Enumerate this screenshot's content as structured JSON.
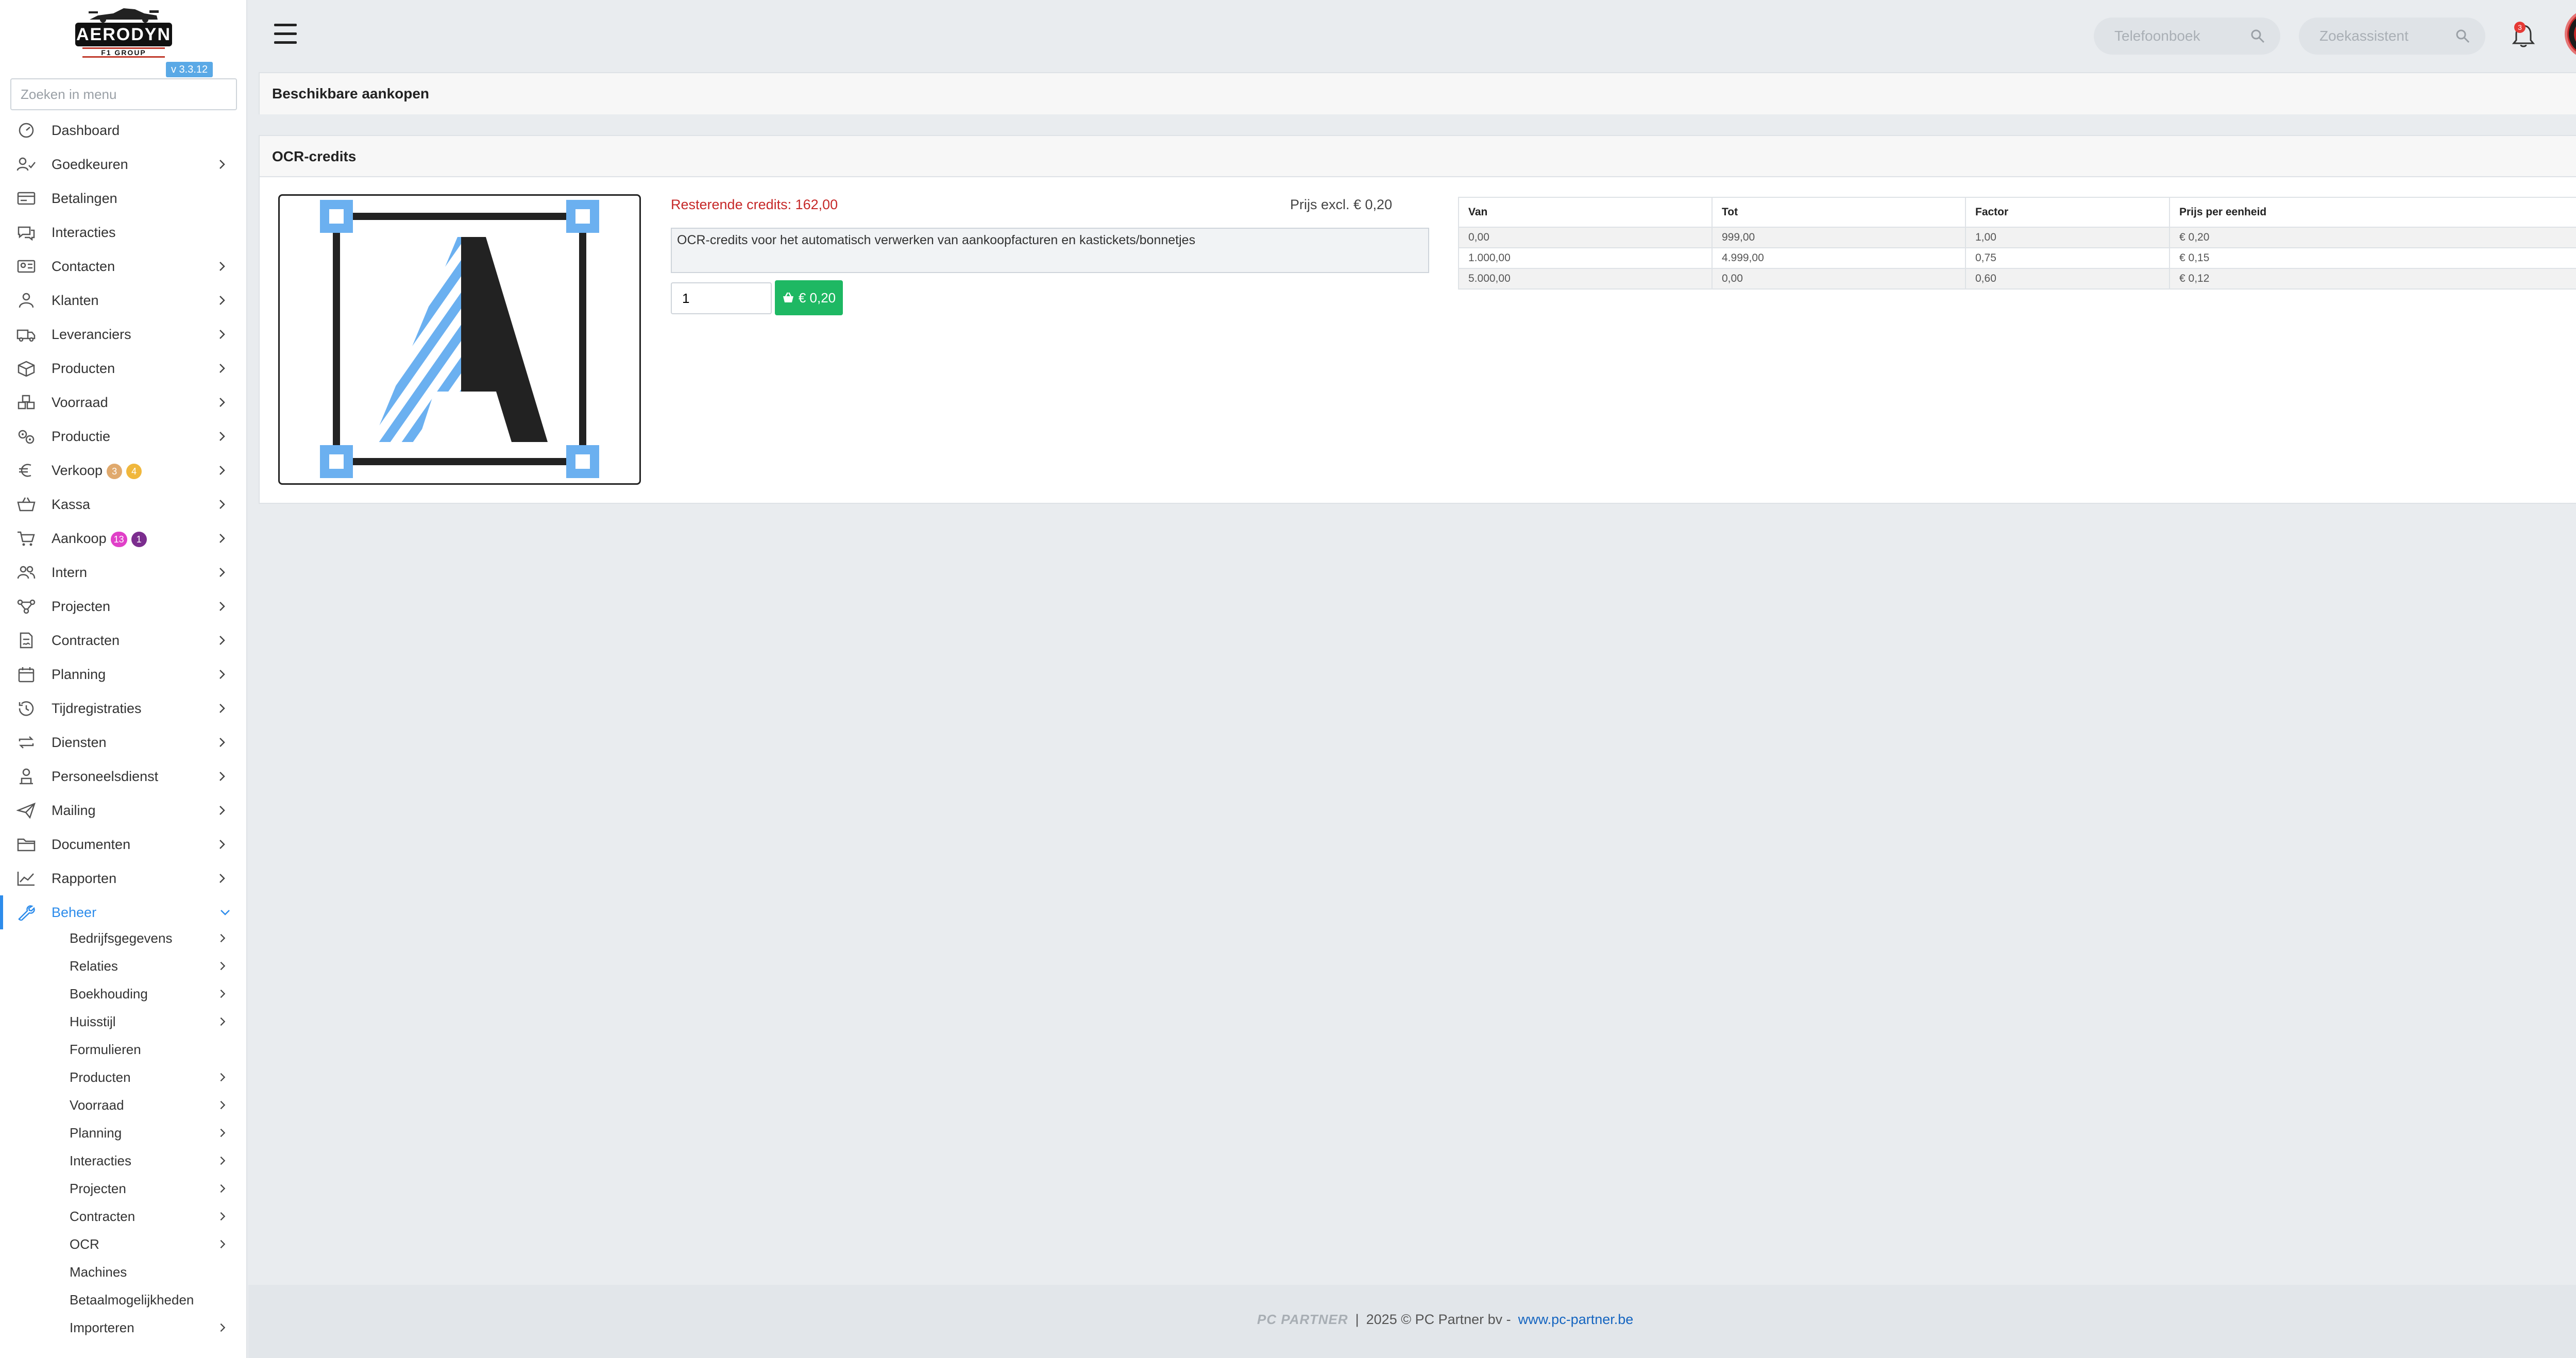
{
  "app": {
    "logo_text": "AERODYN",
    "logo_sub": "F1 GROUP",
    "version": "v 3.3.12"
  },
  "sidebar": {
    "search_placeholder": "Zoeken in menu",
    "items": [
      {
        "label": "Dashboard",
        "icon": "dashboard-icon",
        "chevron": false
      },
      {
        "label": "Goedkeuren",
        "icon": "approve-icon",
        "chevron": true
      },
      {
        "label": "Betalingen",
        "icon": "payments-icon",
        "chevron": false
      },
      {
        "label": "Interacties",
        "icon": "chat-icon",
        "chevron": false
      },
      {
        "label": "Contacten",
        "icon": "contact-card-icon",
        "chevron": true
      },
      {
        "label": "Klanten",
        "icon": "customer-icon",
        "chevron": true
      },
      {
        "label": "Leveranciers",
        "icon": "truck-icon",
        "chevron": true
      },
      {
        "label": "Producten",
        "icon": "box-icon",
        "chevron": true
      },
      {
        "label": "Voorraad",
        "icon": "boxes-icon",
        "chevron": true
      },
      {
        "label": "Productie",
        "icon": "gears-icon",
        "chevron": true
      },
      {
        "label": "Verkoop",
        "icon": "euro-icon",
        "chevron": true,
        "badges": [
          {
            "text": "3",
            "color": "#e0a96d"
          },
          {
            "text": "4",
            "color": "#f0b73c"
          }
        ]
      },
      {
        "label": "Kassa",
        "icon": "basket-icon",
        "chevron": true
      },
      {
        "label": "Aankoop",
        "icon": "cart-icon",
        "chevron": true,
        "badges": [
          {
            "text": "13",
            "color": "#e040c8"
          },
          {
            "text": "1",
            "color": "#7b2d8e"
          }
        ]
      },
      {
        "label": "Intern",
        "icon": "users-icon",
        "chevron": true
      },
      {
        "label": "Projecten",
        "icon": "project-icon",
        "chevron": true
      },
      {
        "label": "Contracten",
        "icon": "contract-icon",
        "chevron": true
      },
      {
        "label": "Planning",
        "icon": "calendar-icon",
        "chevron": true
      },
      {
        "label": "Tijdregistraties",
        "icon": "clock-icon",
        "chevron": true
      },
      {
        "label": "Diensten",
        "icon": "repeat-icon",
        "chevron": true
      },
      {
        "label": "Personeelsdienst",
        "icon": "person-icon",
        "chevron": true
      },
      {
        "label": "Mailing",
        "icon": "send-icon",
        "chevron": true
      },
      {
        "label": "Documenten",
        "icon": "folder-icon",
        "chevron": true
      },
      {
        "label": "Rapporten",
        "icon": "chart-line-icon",
        "chevron": true
      },
      {
        "label": "Beheer",
        "icon": "wrench-icon",
        "chevron": true,
        "active": true
      }
    ],
    "subitems": [
      {
        "label": "Bedrijfsgegevens",
        "chevron": true
      },
      {
        "label": "Relaties",
        "chevron": true
      },
      {
        "label": "Boekhouding",
        "chevron": true
      },
      {
        "label": "Huisstijl",
        "chevron": true
      },
      {
        "label": "Formulieren",
        "chevron": false
      },
      {
        "label": "Producten",
        "chevron": true
      },
      {
        "label": "Voorraad",
        "chevron": true
      },
      {
        "label": "Planning",
        "chevron": true
      },
      {
        "label": "Interacties",
        "chevron": true
      },
      {
        "label": "Projecten",
        "chevron": true
      },
      {
        "label": "Contracten",
        "chevron": true
      },
      {
        "label": "OCR",
        "chevron": true
      },
      {
        "label": "Machines",
        "chevron": false
      },
      {
        "label": "Betaalmogelijkheden",
        "chevron": false
      },
      {
        "label": "Importeren",
        "chevron": true
      }
    ]
  },
  "topbar": {
    "phonebook_placeholder": "Telefoonboek",
    "assistant_placeholder": "Zoekassistent",
    "notification_count": "3"
  },
  "page": {
    "section_title": "Beschikbare aankopen",
    "product": {
      "title": "OCR-credits",
      "remaining": "Resterende credits: 162,00",
      "price_excl": "Prijs excl. € 0,20",
      "description": "OCR-credits voor het automatisch verwerken van aankoopfacturen en kastickets/bonnetjes",
      "quantity": "1",
      "buy_label": "€ 0,20"
    },
    "price_table": {
      "headers": [
        "Van",
        "Tot",
        "Factor",
        "Prijs per eenheid"
      ],
      "rows": [
        [
          "0,00",
          "999,00",
          "1,00",
          "€ 0,20"
        ],
        [
          "1.000,00",
          "4.999,00",
          "0,75",
          "€ 0,15"
        ],
        [
          "5.000,00",
          "0,00",
          "0,60",
          "€ 0,12"
        ]
      ]
    }
  },
  "footer": {
    "logo": "PC PARTNER",
    "separator": "|",
    "copyright": "2025 © PC Partner bv -",
    "link": "www.pc-partner.be"
  },
  "colors": {
    "accent": "#2d8ceb",
    "buy_button": "#1eb863",
    "remaining_credits": "#c62828",
    "ocr_logo_blue": "#6bb0f0"
  }
}
